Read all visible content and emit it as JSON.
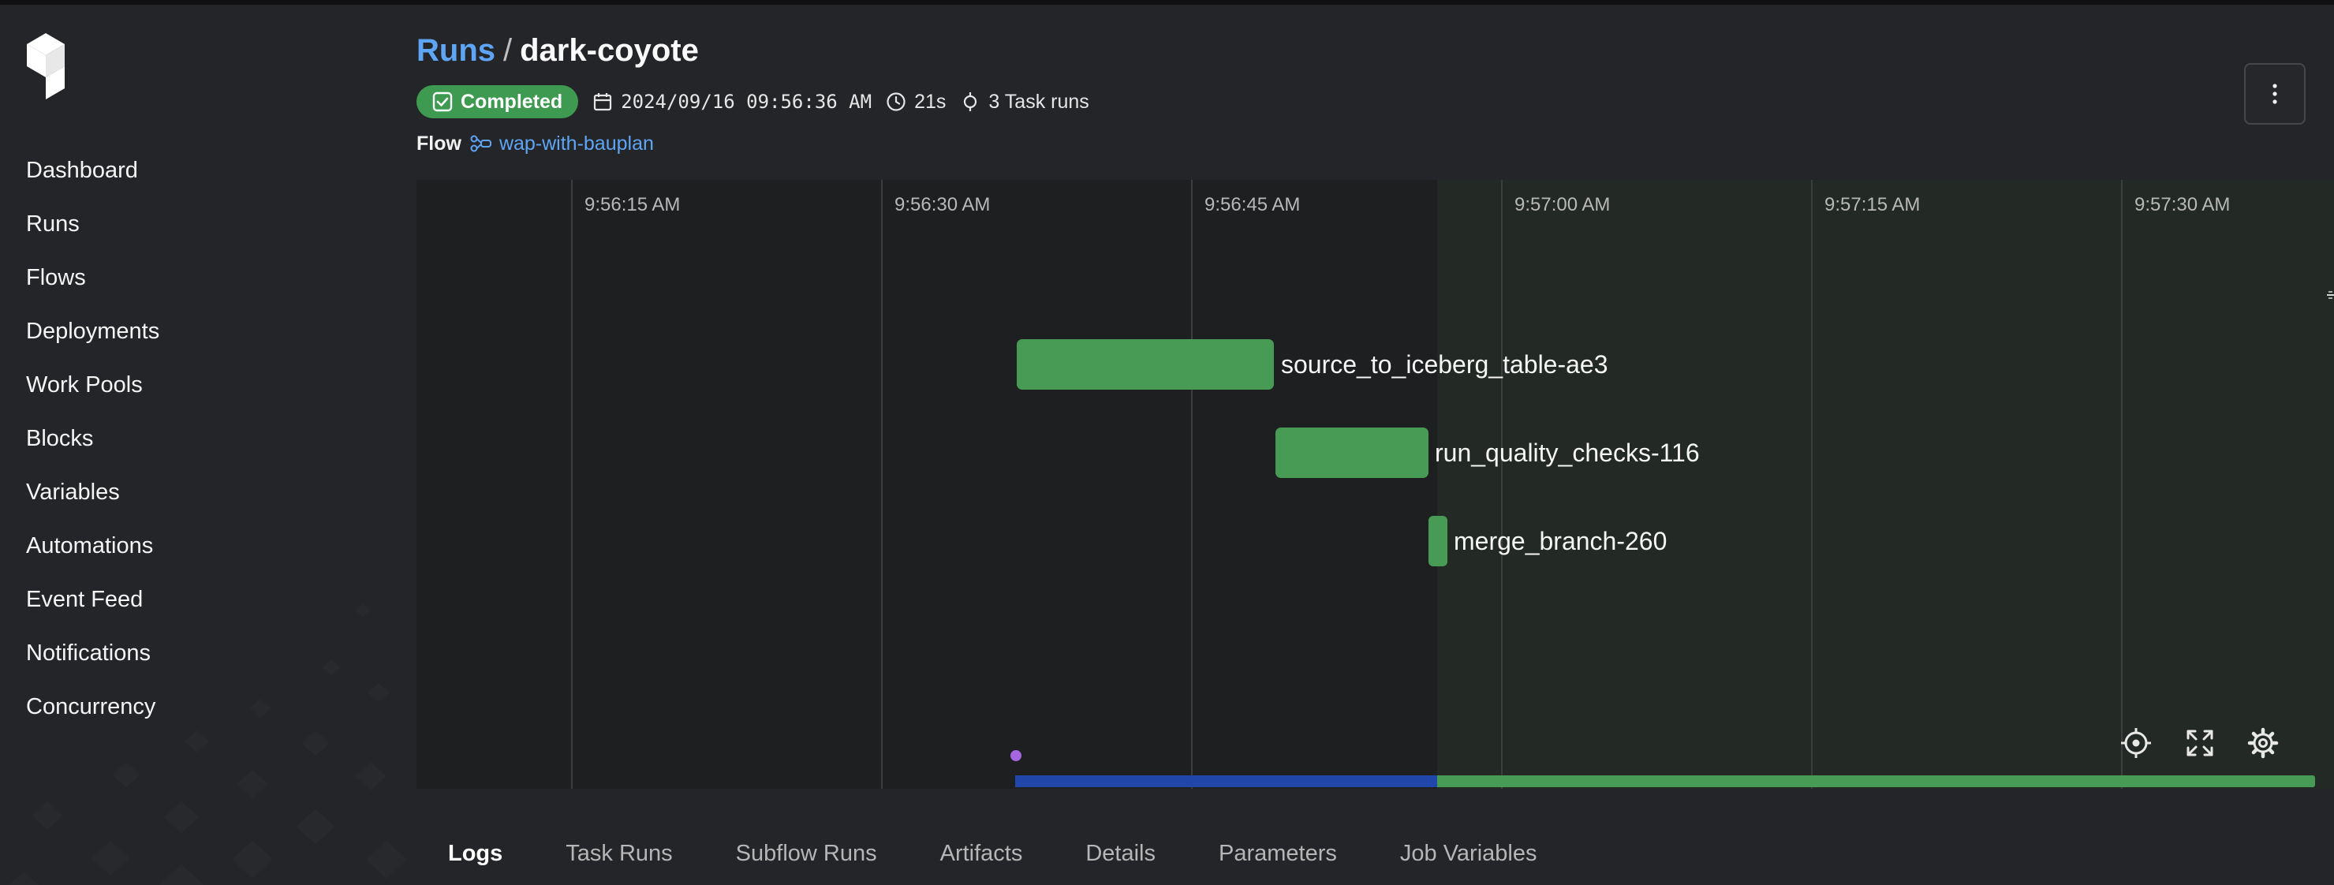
{
  "sidebar": {
    "items": [
      {
        "label": "Dashboard"
      },
      {
        "label": "Runs"
      },
      {
        "label": "Flows"
      },
      {
        "label": "Deployments"
      },
      {
        "label": "Work Pools"
      },
      {
        "label": "Blocks"
      },
      {
        "label": "Variables"
      },
      {
        "label": "Automations"
      },
      {
        "label": "Event Feed"
      },
      {
        "label": "Notifications"
      },
      {
        "label": "Concurrency"
      }
    ]
  },
  "header": {
    "breadcrumb_root": "Runs",
    "separator": "/",
    "run_name": "dark-coyote",
    "status": "Completed",
    "start_time": "2024/09/16 09:56:36 AM",
    "duration": "21s",
    "task_runs": "3 Task runs",
    "flow_label": "Flow",
    "flow_name": "wap-with-bauplan"
  },
  "timeline": {
    "ticks": [
      "9:56:15 AM",
      "9:56:30 AM",
      "9:56:45 AM",
      "9:57:00 AM",
      "9:57:15 AM",
      "9:57:30 AM"
    ],
    "tasks": [
      {
        "name": "source_to_iceberg_table-ae3",
        "start": "9:56:36 AM",
        "end": "9:56:48 AM"
      },
      {
        "name": "run_quality_checks-116",
        "start": "9:56:48 AM",
        "end": "9:56:56 AM"
      },
      {
        "name": "merge_branch-260",
        "start": "9:56:56 AM",
        "end": "9:56:57 AM"
      }
    ],
    "icons": [
      "crosshair-icon",
      "expand-icon",
      "gear-icon"
    ],
    "colors": {
      "task": "#489b54",
      "completed": "#489b54",
      "running": "#1f46a8",
      "event_dot": "#a567e0"
    }
  },
  "tabs": [
    {
      "label": "Logs",
      "active": true
    },
    {
      "label": "Task Runs"
    },
    {
      "label": "Subflow Runs"
    },
    {
      "label": "Artifacts"
    },
    {
      "label": "Details"
    },
    {
      "label": "Parameters"
    },
    {
      "label": "Job Variables"
    }
  ],
  "colors": {
    "accent": "#5ea6f5",
    "success": "#3e9a50",
    "background": "#242528"
  }
}
